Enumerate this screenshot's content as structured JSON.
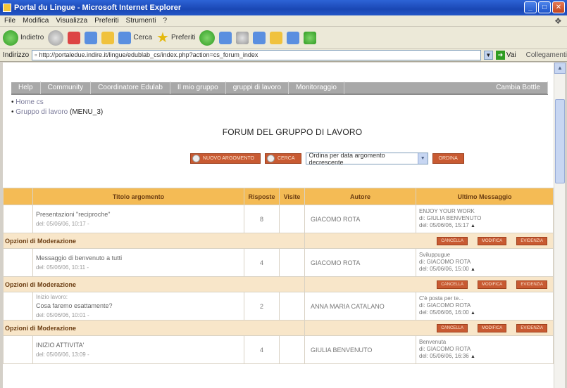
{
  "window": {
    "title": "Portal du Lingue - Microsoft Internet Explorer",
    "buttons": {
      "minimize": "_",
      "maximize": "□",
      "close": "✕"
    }
  },
  "menubar": {
    "items": [
      "File",
      "Modifica",
      "Visualizza",
      "Preferiti",
      "Strumenti",
      "?"
    ]
  },
  "toolbar": {
    "back_label": "Indietro",
    "search_label": "Cerca",
    "favorites_label": "Preferiti"
  },
  "addressbar": {
    "label": "Indirizzo",
    "url": "http://portaledue.indire.it/lingue/edublab_cs/index.php?action=cs_forum_index",
    "go_label": "Vai",
    "links_label": "Collegamenti"
  },
  "nav": {
    "items": [
      "Help",
      "Community",
      "Coordinatore Edulab",
      "Il mio gruppo",
      "gruppi di lavoro",
      "Monitoraggio"
    ],
    "right_item": "Cambia Bottle"
  },
  "breadcrumb": {
    "home": "Home cs",
    "group_link": "Gruppo di lavoro",
    "group_current": "(MENU_3)"
  },
  "page_title": "FORUM DEL GRUPPO DI LAVORO",
  "actions": {
    "new_topic": "NUOVO ARGOMENTO",
    "search": "CERCA",
    "sort_selected": "Ordina per data argomento decrescente",
    "sort_button": "ORDINA"
  },
  "table": {
    "headers": {
      "title": "Titolo argomento",
      "replies": "Risposte",
      "visits": "Visite",
      "author": "Autore",
      "last": "Ultimo Messaggio"
    },
    "topics": [
      {
        "pre": "",
        "title": "Presentazioni \"reciproche\"",
        "date": "del: 05/06/06, 10:17 -",
        "replies": "8",
        "visits": "",
        "author": "GIACOMO ROTA",
        "last_title": "ENJOY YOUR WORK",
        "last_by": "di: GIULIA BENVENUTO",
        "last_date": "del: 05/06/06, 15:17"
      },
      {
        "pre": "",
        "title": "Messaggio di benvenuto a tutti",
        "date": "del: 05/06/06, 10:11 -",
        "replies": "4",
        "visits": "",
        "author": "GIACOMO ROTA",
        "last_title": "Sviluppugue",
        "last_by": "di: GIACOMO ROTA",
        "last_date": "del: 05/06/06, 15:00"
      },
      {
        "pre": "Inizio lavoro:",
        "title": "Cosa faremo esattamente?",
        "date": "del: 05/06/06, 10:01 -",
        "replies": "2",
        "visits": "",
        "author": "ANNA MARIA CATALANO",
        "last_title": "C'è posta per te...",
        "last_by": "di: GIACOMO ROTA",
        "last_date": "del: 05/06/06, 16:00"
      },
      {
        "pre": "",
        "title": "INIZIO ATTIVITA'",
        "date": "del: 05/06/06, 13:09 -",
        "replies": "4",
        "visits": "",
        "author": "GIULIA BENVENUTO",
        "last_title": "Benvenuta",
        "last_by": "di: GIACOMO ROTA",
        "last_date": "del: 05/06/06, 16:36"
      }
    ],
    "moderation": {
      "label": "Opzioni di Moderazione",
      "delete": "CANCELLA",
      "edit": "MODIFICA",
      "highlight": "EVIDENZIA"
    }
  },
  "colors": {
    "header_orange": "#f4bb55",
    "moderation_bg": "#f8e6c9",
    "button_brown": "#c85a32",
    "nav_gray": "#a8a8a8"
  }
}
